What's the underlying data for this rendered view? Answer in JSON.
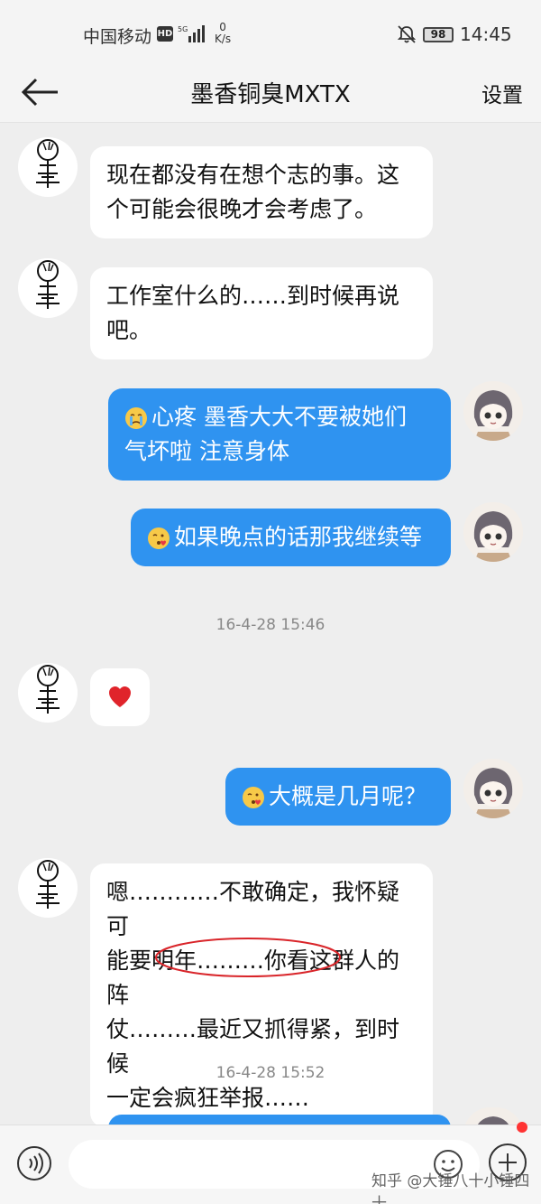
{
  "status_bar": {
    "carrier": "中国移动",
    "hd": "HD",
    "speed_value": "0",
    "speed_unit": "K/s",
    "battery": "98",
    "time": "14:45"
  },
  "header": {
    "title": "墨香铜臭MXTX",
    "settings": "设置",
    "back_icon": "arrow-left-icon"
  },
  "messages": [
    {
      "side": "in",
      "lines": [
        "现在都没有在想个志的事。这",
        "个可能会很晚才会考虑了。"
      ]
    },
    {
      "side": "in",
      "lines": [
        "工作室什么的……到时候再说",
        "吧。"
      ]
    },
    {
      "side": "out",
      "emoji": "crying-face-icon",
      "lines": [
        "心疼  墨香大大不要被她们",
        "气坏啦 注意身体"
      ]
    },
    {
      "side": "out",
      "emoji": "blowing-kiss-icon",
      "lines": [
        "如果晚点的话那我继续等"
      ]
    },
    {
      "side": "in",
      "emoji": "red-heart-icon",
      "lines": []
    },
    {
      "side": "out",
      "emoji": "blowing-kiss-icon",
      "lines": [
        "大概是几月呢？"
      ]
    },
    {
      "side": "in",
      "lines": [
        "嗯…………不敢确定，我怀疑可",
        "能要明年………你看这群人的阵",
        "仗………最近又抓得紧，到时候",
        "一定会疯狂举报……"
      ]
    }
  ],
  "timestamps": [
    "16-4-28 15:46",
    "16-4-28 15:52"
  ],
  "input_bar": {
    "placeholder": "",
    "voice_icon": "voice-icon",
    "emoji_icon": "smiley-icon",
    "plus_icon": "plus-icon"
  },
  "watermark": "知乎 @大锤八十小锤四十",
  "colors": {
    "background": "#eeeeee",
    "bubble_in": "#ffffff",
    "bubble_out": "#2f93f0",
    "annotation_circle": "#d9252a",
    "notification_dot": "#ff3333"
  }
}
